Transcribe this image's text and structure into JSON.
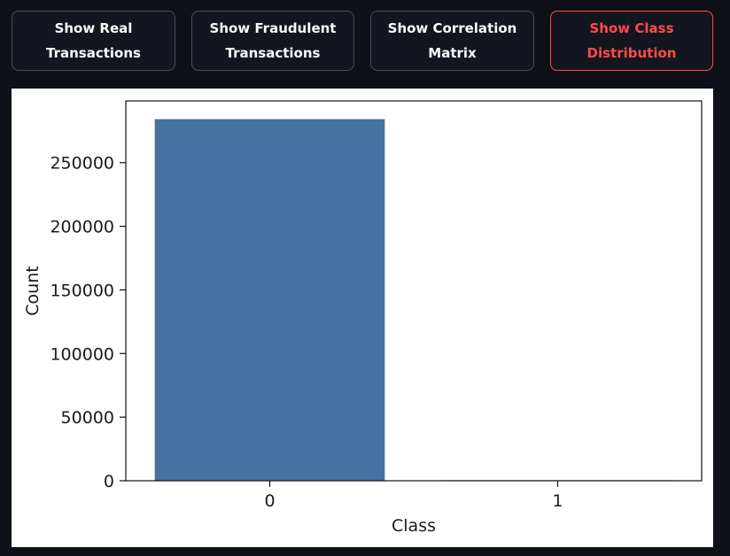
{
  "buttons": [
    {
      "line1": "Show Real",
      "line2": "Transactions",
      "active": false
    },
    {
      "line1": "Show Fraudulent",
      "line2": "Transactions",
      "active": false
    },
    {
      "line1": "Show Correlation",
      "line2": "Matrix",
      "active": false
    },
    {
      "line1": "Show Class",
      "line2": "Distribution",
      "active": true
    }
  ],
  "colors": {
    "background": "#0e1117",
    "button_border": "#4a4d55",
    "active_accent": "#ff4b4b",
    "bar": "#4572a0"
  },
  "chart_data": {
    "type": "bar",
    "categories": [
      "0",
      "1"
    ],
    "values": [
      284315,
      492
    ],
    "xlabel": "Class",
    "ylabel": "Count",
    "ylim": [
      0,
      298531
    ],
    "yticks": [
      0,
      50000,
      100000,
      150000,
      200000,
      250000
    ],
    "grid": false
  }
}
